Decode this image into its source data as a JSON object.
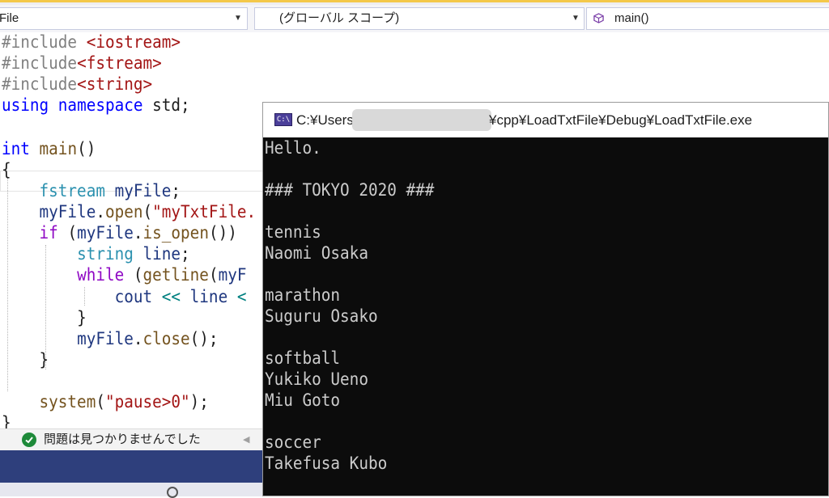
{
  "navbar": {
    "file_combo": "File",
    "scope_combo": "(グローバル スコープ)",
    "member_combo": "main()"
  },
  "code": {
    "l1_inc": "#include",
    "l1_hdr": "<iostream>",
    "l2_inc": "#include",
    "l2_hdr": "<fstream>",
    "l3_inc": "#include",
    "l3_hdr": "<string>",
    "l4_using": "using",
    "l4_namespace": "namespace",
    "l4_std": "std;",
    "l6_int": "int",
    "l6_main": "main",
    "l6_paren": "()",
    "l7_brace": "{",
    "l8_type": "fstream",
    "l8_var": "myFile",
    "l8_semi": ";",
    "l9_var": "myFile",
    "l9_dot": ".",
    "l9_fn": "open",
    "l9_paren": "(",
    "l9_str": "\"myTxtFile.",
    "l10_if": "if",
    "l10_paren": "(",
    "l10_var": "myFile",
    "l10_dot": ".",
    "l10_fn": "is_open",
    "l10_end": "())",
    "l11_type": "string",
    "l11_var": "line",
    "l11_semi": ";",
    "l12_while": "while",
    "l12_paren": "(",
    "l12_fn": "getline",
    "l12_paren2": "(",
    "l12_var": "myF",
    "l13_cout": "cout",
    "l13_op": "<<",
    "l13_var": "line",
    "l13_op2": "<",
    "l14_brace": "}",
    "l15_var": "myFile",
    "l15_dot": ".",
    "l15_fn": "close",
    "l15_end": "();",
    "l16_brace": "}",
    "l18_fn": "system",
    "l18_paren": "(",
    "l18_str": "\"pause>0\"",
    "l18_end": ");",
    "l19_brace": "}"
  },
  "status": {
    "message": "問題は見つかりませんでした"
  },
  "console": {
    "title_prefix": "C:¥Users",
    "title_suffix": "¥cpp¥LoadTxtFile¥Debug¥LoadTxtFile.exe",
    "icon_text": "C:\\",
    "lines": [
      "Hello.",
      "",
      "### TOKYO 2020 ###",
      "",
      "tennis",
      "Naomi Osaka",
      "",
      "marathon",
      "Suguru Osako",
      "",
      "softball",
      "Yukiko Ueno",
      "Miu Goto",
      "",
      "soccer",
      "Takefusa Kubo"
    ]
  },
  "colors": {
    "keyword": "#0000ff",
    "type": "#2b91af",
    "string": "#a31515",
    "preprocessor": "#808080",
    "function": "#74531f",
    "variable": "#1f377f",
    "control": "#8f08c4",
    "console_bg": "#0c0c0c",
    "console_text": "#cccccc"
  }
}
